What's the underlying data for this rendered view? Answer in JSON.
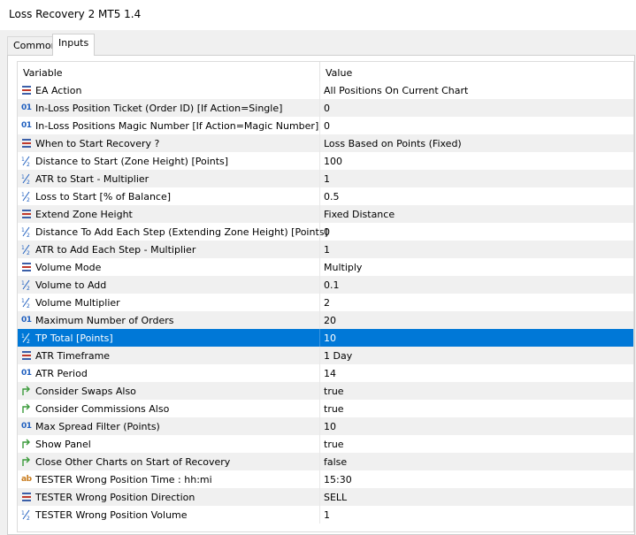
{
  "window": {
    "title": "Loss Recovery 2 MT5 1.4"
  },
  "tabs": [
    {
      "label": "Common"
    },
    {
      "label": "Inputs"
    }
  ],
  "table": {
    "headers": {
      "variable": "Variable",
      "value": "Value"
    },
    "rows": [
      {
        "icon": "enum-icon",
        "name": "EA Action",
        "value": "All Positions On Current Chart"
      },
      {
        "icon": "int-icon",
        "name": "In-Loss Position Ticket (Order ID) [If Action=Single]",
        "value": "0"
      },
      {
        "icon": "int-icon",
        "name": "In-Loss Positions Magic Number [If Action=Magic Number]",
        "value": "0"
      },
      {
        "icon": "enum-icon",
        "name": "When to Start Recovery ?",
        "value": "Loss Based on Points (Fixed)"
      },
      {
        "icon": "double-icon",
        "name": "Distance to Start (Zone Height) [Points]",
        "value": "100"
      },
      {
        "icon": "double-icon",
        "name": "ATR to Start - Multiplier",
        "value": "1"
      },
      {
        "icon": "double-icon",
        "name": "Loss to Start [% of Balance]",
        "value": "0.5"
      },
      {
        "icon": "enum-icon",
        "name": "Extend Zone Height",
        "value": "Fixed Distance"
      },
      {
        "icon": "double-icon",
        "name": "Distance To Add Each Step (Extending Zone Height) [Points]",
        "value": "0"
      },
      {
        "icon": "double-icon",
        "name": "ATR to Add Each Step - Multiplier",
        "value": "1"
      },
      {
        "icon": "enum-icon",
        "name": "Volume Mode",
        "value": "Multiply"
      },
      {
        "icon": "double-icon",
        "name": "Volume to Add",
        "value": "0.1"
      },
      {
        "icon": "double-icon",
        "name": "Volume Multiplier",
        "value": "2"
      },
      {
        "icon": "int-icon",
        "name": "Maximum Number of Orders",
        "value": "20"
      },
      {
        "icon": "double-icon",
        "name": "TP Total [Points]",
        "value": "10",
        "selected": true
      },
      {
        "icon": "enum-icon",
        "name": "ATR Timeframe",
        "value": "1 Day"
      },
      {
        "icon": "int-icon",
        "name": "ATR Period",
        "value": "14"
      },
      {
        "icon": "bool-icon",
        "name": "Consider Swaps Also",
        "value": "true"
      },
      {
        "icon": "bool-icon",
        "name": "Consider Commissions Also",
        "value": "true"
      },
      {
        "icon": "int-icon",
        "name": "Max Spread Filter (Points)",
        "value": "10"
      },
      {
        "icon": "bool-icon",
        "name": "Show Panel",
        "value": "true"
      },
      {
        "icon": "bool-icon",
        "name": "Close Other Charts on Start of Recovery",
        "value": "false"
      },
      {
        "icon": "string-icon",
        "name": "TESTER Wrong Position Time : hh:mi",
        "value": "15:30"
      },
      {
        "icon": "enum-icon",
        "name": "TESTER Wrong Position Direction",
        "value": "SELL"
      },
      {
        "icon": "double-icon",
        "name": "TESTER Wrong Position Volume",
        "value": "1"
      }
    ]
  },
  "icon_glyphs": {
    "int-icon": "01",
    "string-icon": "ab"
  },
  "colors": {
    "selection": "#0078d7",
    "int_icon": "#1f5fbf",
    "string_icon": "#c87b1c",
    "bool_icon": "#3a9a3a",
    "enum_icon": "#3b5fa8"
  }
}
